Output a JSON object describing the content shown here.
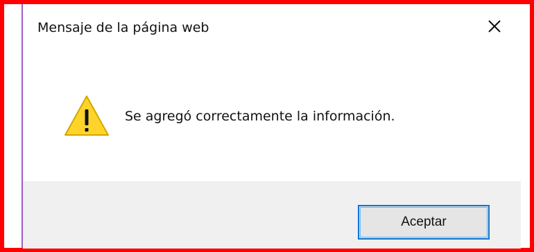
{
  "dialog": {
    "title": "Mensaje de la página web",
    "message": "Se agregó correctamente la información.",
    "ok_label": "Aceptar",
    "icons": {
      "close": "close-icon",
      "warning": "warning-icon"
    }
  },
  "colors": {
    "outer_border": "#ff0000",
    "dialog_background": "#ffffff",
    "footer_background": "#f0f0f0",
    "button_border": "#0a74d6",
    "warning_fill": "#ffd42a",
    "text": "#111111"
  }
}
